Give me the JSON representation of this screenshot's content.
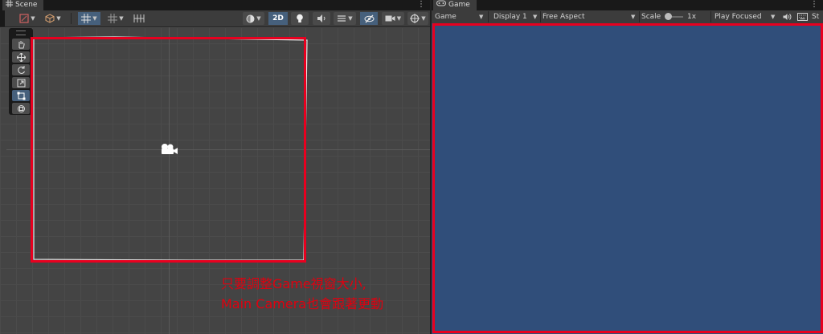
{
  "scene": {
    "tab_label": "Scene",
    "tab_icon": "grid-icon",
    "toolbar_2d_label": "2D"
  },
  "game": {
    "tab_label": "Game",
    "tab_icon": "gamepad-icon",
    "view_dropdown": "Game",
    "display_dropdown": "Display 1",
    "aspect_dropdown": "Free Aspect",
    "scale_label": "Scale",
    "scale_value": "1x",
    "play_mode_dropdown": "Play Focused",
    "stats_label": "St",
    "viewport_color": "#304e7a"
  },
  "annotation": {
    "line1": "只要調整Game視窗大小,",
    "line2": "Main Camera也會跟著更動",
    "color": "#e0000f"
  },
  "colors": {
    "panel_bg": "#282828",
    "toolbar_bg": "#3c3c3c",
    "active_button": "#46607c",
    "highlight_red": "#e8001f"
  }
}
